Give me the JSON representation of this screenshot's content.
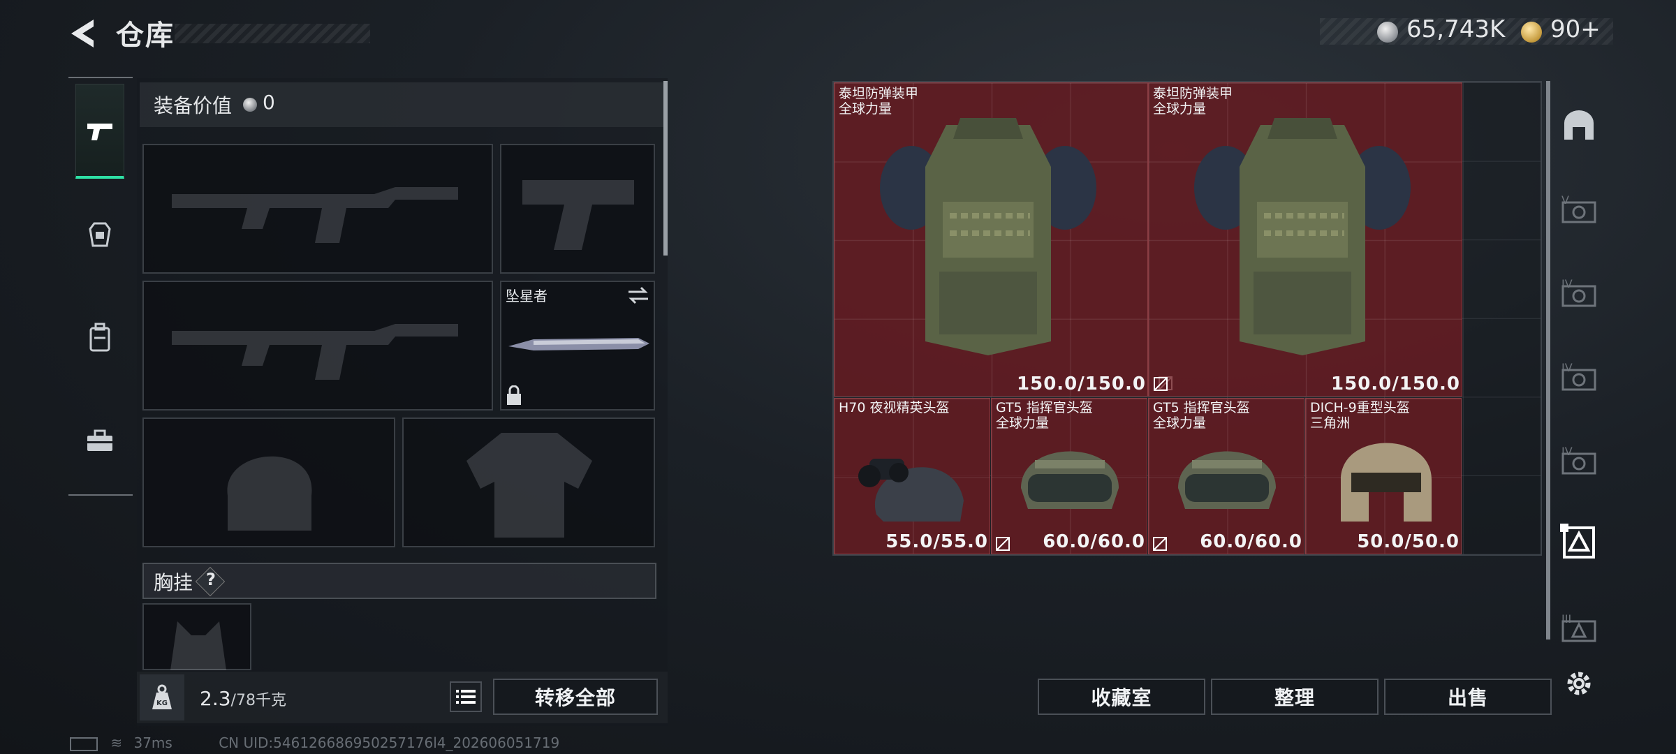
{
  "header": {
    "back_icon": "chevron-left-icon",
    "title": "仓库",
    "money": "65,743K",
    "money_icon": "silver-coin-icon",
    "tickets": "90+",
    "tickets_icon": "gold-ticket-icon"
  },
  "left_rail": {
    "tabs": [
      {
        "icon": "pistol-icon",
        "active": true
      },
      {
        "icon": "armor-icon",
        "active": false
      },
      {
        "icon": "backpack-icon",
        "active": false
      },
      {
        "icon": "toolbox-icon",
        "active": false
      }
    ]
  },
  "loadout": {
    "equip_value_label": "装备价值",
    "equip_value": "0",
    "melee_name": "坠星者",
    "chest_label": "胸挂",
    "chest_help": "?",
    "weight_current": "2.3",
    "weight_max": "/78千克",
    "transfer_all": "转移全部"
  },
  "stash": {
    "items": [
      {
        "name": "泰坦防弹装甲",
        "sub": "全球力量",
        "durability": "150.0/150.0"
      },
      {
        "name": "泰坦防弹装甲",
        "sub": "全球力量",
        "durability": "150.0/150.0"
      },
      {
        "name": "H70 夜视精英头盔",
        "sub": "",
        "durability": "55.0/55.0"
      },
      {
        "name": "GT5 指挥官头盔",
        "sub": "全球力量",
        "durability": "60.0/60.0"
      },
      {
        "name": "GT5 指挥官头盔",
        "sub": "全球力量",
        "durability": "60.0/60.0"
      },
      {
        "name": "DICH-9重型头盔",
        "sub": "三角洲",
        "durability": "50.0/50.0"
      }
    ]
  },
  "actions": {
    "collection": "收藏室",
    "sort": "整理",
    "sell": "出售"
  },
  "status": {
    "ping": "37ms",
    "uid": "CN UID:546126686950257176l4_202606051719"
  },
  "colors": {
    "accent": "#2ee0a5",
    "item_bg": "#6e1c22"
  }
}
